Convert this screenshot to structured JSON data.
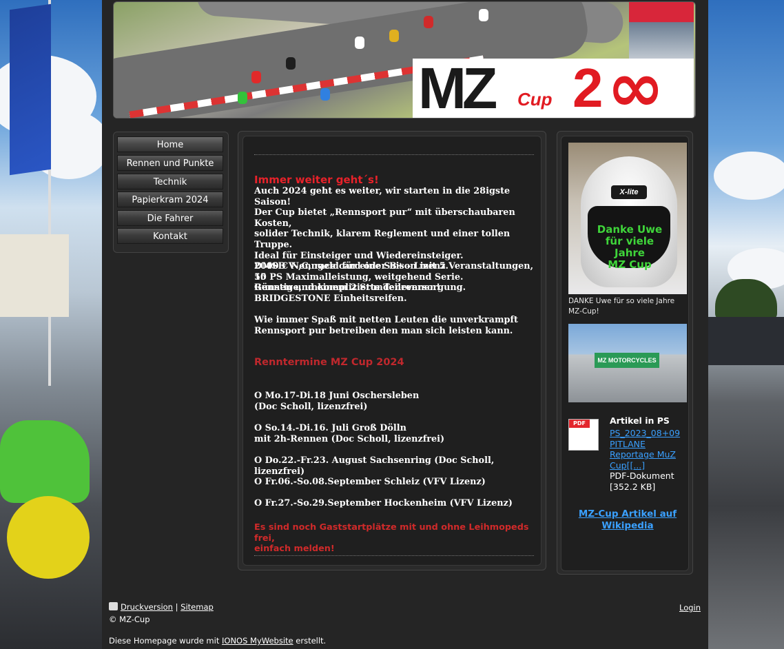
{
  "nav": {
    "items": [
      {
        "label": "Home"
      },
      {
        "label": "Rennen und Punkte"
      },
      {
        "label": "Technik"
      },
      {
        "label": "Papierkram 2024"
      },
      {
        "label": "Die Fahrer"
      },
      {
        "label": "Kontakt"
      }
    ]
  },
  "header": {
    "logo_mz": "MZ",
    "logo_cup": "Cup",
    "logo_num": "2",
    "logo_inf": "∞"
  },
  "content": {
    "headline": "Immer weiter geht´s!",
    "intro": "Auch 2024 geht es weiter, wir starten  in die 28igste Saison!\nDer Cup bietet „Rennsport pur“  mit überschaubaren Kosten,\nsolider Technik,  klarem Reglement und einer tollen Truppe.\nIdeal für Einsteiger und Wiedereinsteiger.\n2000 € Nenngeld für eine Saison mit 5 Veranstaltungen, 10\nRennen und einem 2 Stundenrennen!",
    "rules": "DMSB V-,C, race card oder B+ - Lizenz.\n55 PS Maximalleistung,   weitgehend Serie.\nGünstige, unkomplizierte Teileversorgung.\nBRIDGESTONE Einheitsreifen.",
    "fun": "Wie immer Spaß mit netten Leuten die unverkrampft\nRennsport  pur betreiben den man sich leisten kann.",
    "schedule_title": "Renntermine MZ Cup 2024",
    "events": [
      {
        "text": "O Mo.17-Di.18 Juni Oschersleben\n   (Doc Scholl, lizenzfrei)"
      },
      {
        "text": "O So.14.-Di.16. Juli Groß Dölln\n   mit 2h-Rennen (Doc Scholl, lizenzfrei)"
      },
      {
        "text": "O Do.22.-Fr.23. August Sachsenring (Doc Scholl, lizenzfrei)"
      },
      {
        "text": "O Fr.06.-So.08.September Schleiz (VFV Lizenz)"
      },
      {
        "text": "O Fr.27.-So.29.September Hockenheim (VFV Lizenz)"
      }
    ],
    "guest_note": "Es sind noch Gaststartplätze mit und ohne Leihmopeds frei,\neinfach melden!"
  },
  "sidebar": {
    "helmet_brand": "X-lite",
    "helmet_text": "Danke Uwe\nfür viele Jahre\nMZ Cup",
    "caption": "DANKE Uwe für so viele Jahre MZ-Cup!",
    "team_banner": "MZ MOTORCYCLES",
    "pdf_icon_label": "PDF",
    "pdf_title": "Artikel in PS",
    "pdf_link": "PS_2023_08+09 PITLANE Reportage MuZ Cup[[...]",
    "pdf_type": "PDF-Dokument\n[352.2 KB]",
    "wiki_link": "MZ-Cup Artikel auf Wikipedia"
  },
  "footer": {
    "print_label": "Druckversion",
    "separator": "|",
    "sitemap_label": "Sitemap",
    "copyright": "© MZ-Cup",
    "login_label": "Login",
    "made_with_prefix": "Diese Homepage wurde mit ",
    "made_with_link": "IONOS MyWebsite",
    "made_with_suffix": " erstellt."
  }
}
